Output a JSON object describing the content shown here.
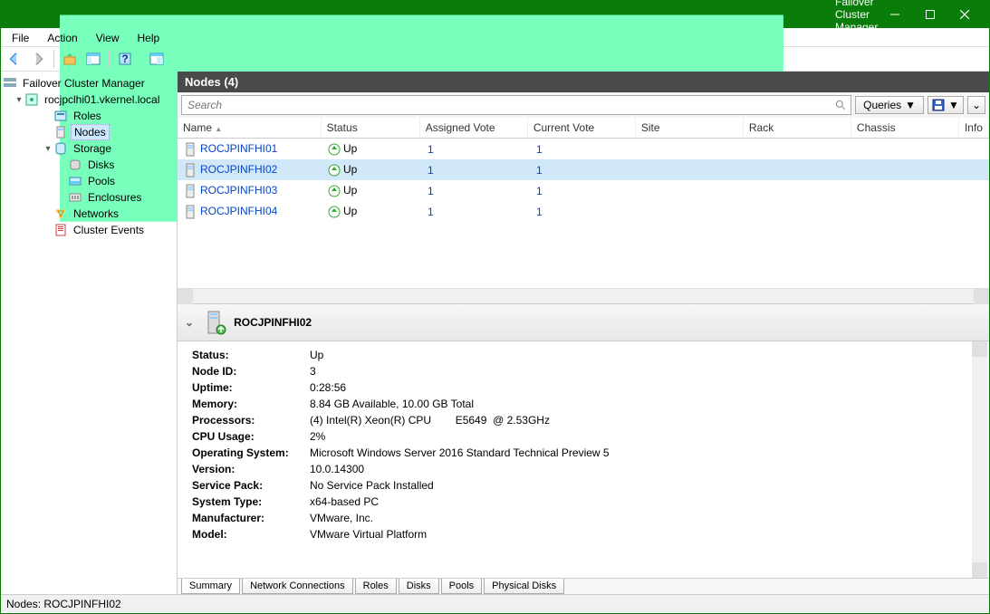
{
  "title": "Failover Cluster Manager",
  "menubar": [
    "File",
    "Action",
    "View",
    "Help"
  ],
  "tree": {
    "root": "Failover Cluster Manager",
    "cluster": "rocjpclhi01.vkernel.local",
    "items": [
      {
        "label": "Roles",
        "indent": 2,
        "icon": "roles"
      },
      {
        "label": "Nodes",
        "indent": 2,
        "icon": "nodes",
        "selected": true
      },
      {
        "label": "Storage",
        "indent": 2,
        "icon": "storage",
        "expand": "▾"
      },
      {
        "label": "Disks",
        "indent": 3,
        "icon": "disks"
      },
      {
        "label": "Pools",
        "indent": 3,
        "icon": "pools"
      },
      {
        "label": "Enclosures",
        "indent": 3,
        "icon": "encl"
      },
      {
        "label": "Networks",
        "indent": 2,
        "icon": "net"
      },
      {
        "label": "Cluster Events",
        "indent": 2,
        "icon": "ev"
      }
    ]
  },
  "panel_title": "Nodes (4)",
  "search_placeholder": "Search",
  "queries_label": "Queries",
  "columns": [
    "Name",
    "Status",
    "Assigned Vote",
    "Current Vote",
    "Site",
    "Rack",
    "Chassis",
    "Information"
  ],
  "rows": [
    {
      "name": "ROCJPINFHI01",
      "status": "Up",
      "av": "1",
      "cv": "1"
    },
    {
      "name": "ROCJPINFHI02",
      "status": "Up",
      "av": "1",
      "cv": "1",
      "selected": true
    },
    {
      "name": "ROCJPINFHI03",
      "status": "Up",
      "av": "1",
      "cv": "1"
    },
    {
      "name": "ROCJPINFHI04",
      "status": "Up",
      "av": "1",
      "cv": "1"
    }
  ],
  "details": {
    "name": "ROCJPINFHI02",
    "kv": [
      {
        "k": "Status:",
        "v": "Up"
      },
      {
        "k": "Node ID:",
        "v": "3"
      },
      {
        "k": "Uptime:",
        "v": "0:28:56"
      },
      {
        "k": "Memory:",
        "v": "8.84 GB Available, 10.00 GB Total"
      },
      {
        "k": "Processors:",
        "v": "(4) Intel(R) Xeon(R) CPU        E5649  @ 2.53GHz"
      },
      {
        "k": "CPU Usage:",
        "v": "2%"
      },
      {
        "k": "Operating System:",
        "v": "Microsoft Windows Server 2016 Standard Technical Preview 5"
      },
      {
        "k": "Version:",
        "v": "10.0.14300"
      },
      {
        "k": "Service Pack:",
        "v": "No Service Pack Installed"
      },
      {
        "k": "System Type:",
        "v": "x64-based PC"
      },
      {
        "k": "Manufacturer:",
        "v": "VMware, Inc."
      },
      {
        "k": "Model:",
        "v": "VMware Virtual Platform"
      }
    ]
  },
  "tabs": [
    "Summary",
    "Network Connections",
    "Roles",
    "Disks",
    "Pools",
    "Physical Disks"
  ],
  "statusbar": "Nodes: ROCJPINFHI02"
}
